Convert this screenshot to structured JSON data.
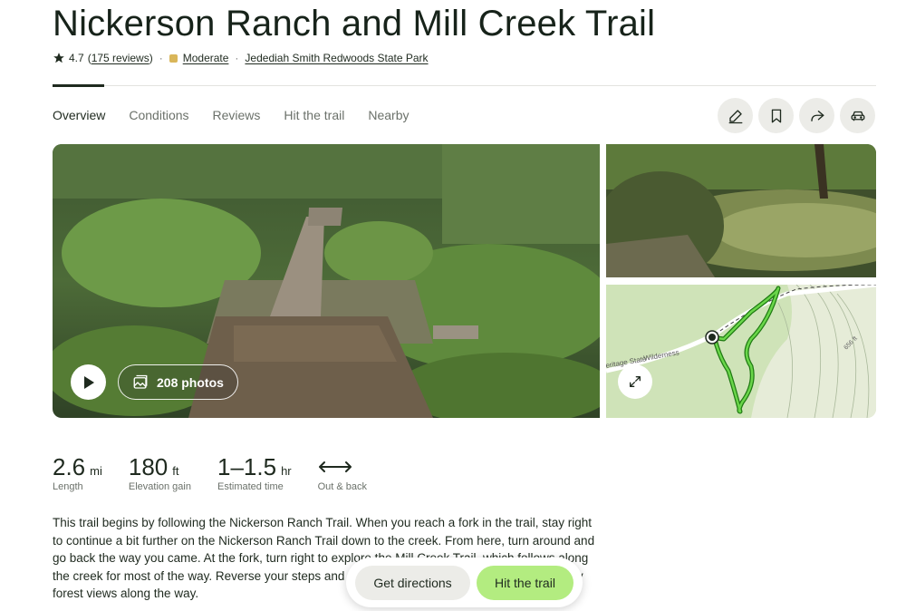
{
  "trail": {
    "title": "Nickerson Ranch and Mill Creek Trail",
    "rating": "4.7",
    "reviews": "175 reviews",
    "difficulty": "Moderate",
    "difficulty_color": "#d9b65a",
    "park": "Jedediah Smith Redwoods State Park"
  },
  "tabs": [
    {
      "label": "Overview",
      "active": true
    },
    {
      "label": "Conditions"
    },
    {
      "label": "Reviews"
    },
    {
      "label": "Hit the trail"
    },
    {
      "label": "Nearby"
    }
  ],
  "actions": [
    "edit-icon",
    "bookmark-icon",
    "share-icon",
    "car-icon"
  ],
  "gallery": {
    "photos_label": "208 photos"
  },
  "map": {
    "label_wilderness": "Wilderness",
    "label_heritage": "eritage State",
    "label_elev": "656 ft"
  },
  "stats": [
    {
      "value": "2.6",
      "unit": "mi",
      "label": "Length"
    },
    {
      "value": "180",
      "unit": "ft",
      "label": "Elevation gain"
    },
    {
      "value": "1–1.5",
      "unit": "hr",
      "label": "Estimated time"
    },
    {
      "label": "Out & back"
    }
  ],
  "description": "This trail begins by following the Nickerson Ranch Trail. When you reach a fork in the trail, stay right to continue a bit further on the Nickerson Ranch Trail down to the creek. From here, turn around and go back the way you came. At the fork, turn right to explore the Mill Creek Trail, which follows along the creek for most of the way. Reverse your steps and head back to the trailhead. There are lovely forest views along the way.",
  "cta": {
    "directions": "Get directions",
    "hit_trail": "Hit the trail"
  },
  "colors": {
    "accent_green": "#b3ec80",
    "trail_line": "#4caf2e"
  }
}
